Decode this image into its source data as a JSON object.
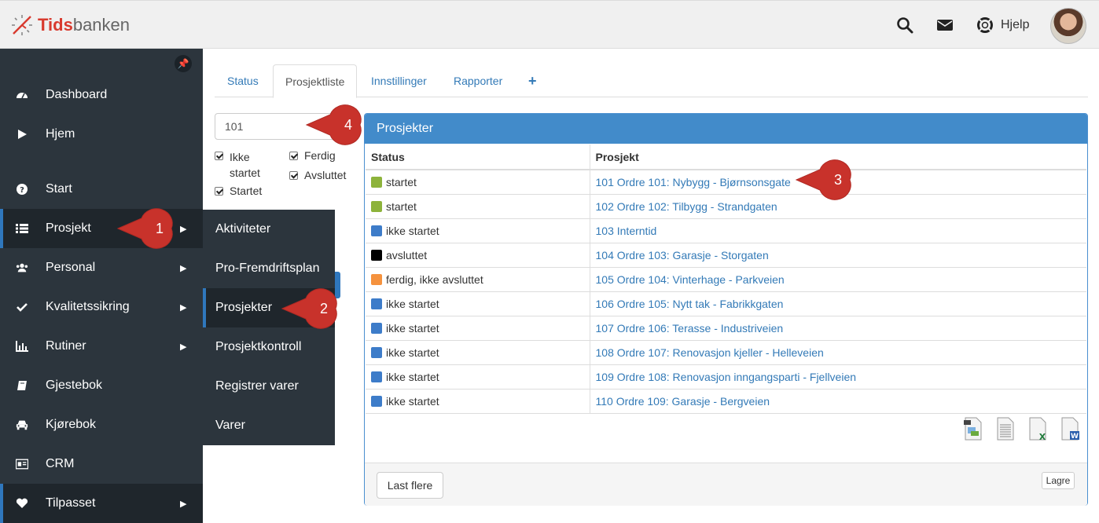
{
  "app": {
    "logo_bold": "Tids",
    "logo_rest": "banken",
    "brand_color": "#d83a2e"
  },
  "header": {
    "help_label": "Hjelp",
    "icons": [
      "search-icon",
      "envelope-icon",
      "lifebuoy-icon"
    ]
  },
  "sidebar": {
    "items": [
      {
        "label": "Dashboard",
        "icon": "dashboard-icon"
      },
      {
        "label": "Hjem",
        "icon": "play-icon"
      },
      {
        "label": "Start",
        "icon": "question-icon"
      },
      {
        "label": "Prosjekt",
        "icon": "list-icon",
        "active": true
      },
      {
        "label": "Personal",
        "icon": "users-icon"
      },
      {
        "label": "Kvalitetssikring",
        "icon": "check-icon"
      },
      {
        "label": "Rutiner",
        "icon": "bar-chart-icon"
      },
      {
        "label": "Gjestebok",
        "icon": "book-icon"
      },
      {
        "label": "Kjørebok",
        "icon": "car-icon"
      },
      {
        "label": "CRM",
        "icon": "id-card-icon"
      },
      {
        "label": "Tilpasset",
        "icon": "heart-icon"
      }
    ]
  },
  "submenu": {
    "items": [
      {
        "label": "Aktiviteter"
      },
      {
        "label": "Pro-Fremdriftsplan"
      },
      {
        "label": "Prosjekter",
        "active": true
      },
      {
        "label": "Prosjektkontroll"
      },
      {
        "label": "Registrer varer"
      },
      {
        "label": "Varer"
      }
    ]
  },
  "tabs": [
    {
      "label": "Status"
    },
    {
      "label": "Prosjektliste",
      "active": true
    },
    {
      "label": "Innstillinger"
    },
    {
      "label": "Rapporter"
    },
    {
      "label": "+"
    }
  ],
  "filter": {
    "search_value": "101",
    "checkboxes": [
      {
        "label": "Ikke startet",
        "checked": true
      },
      {
        "label": "Ferdig",
        "checked": true
      },
      {
        "label": "Startet",
        "checked": true
      },
      {
        "label": "Avsluttet",
        "checked": true
      }
    ]
  },
  "panel": {
    "title": "Prosjekter",
    "columns": [
      "Status",
      "Prosjekt"
    ],
    "rows": [
      {
        "status": "startet",
        "color": "#8db33b",
        "project": "101 Ordre 101: Nybygg - Bjørnsonsgate"
      },
      {
        "status": "startet",
        "color": "#8db33b",
        "project": "102 Ordre 102: Tilbygg - Strandgaten"
      },
      {
        "status": "ikke startet",
        "color": "#3d7cc9",
        "project": "103 Interntid"
      },
      {
        "status": "avsluttet",
        "color": "#000000",
        "project": "104 Ordre 103: Garasje - Storgaten"
      },
      {
        "status": "ferdig, ikke avsluttet",
        "color": "#f5923e",
        "project": "105 Ordre 104: Vinterhage - Parkveien"
      },
      {
        "status": "ikke startet",
        "color": "#3d7cc9",
        "project": "106 Ordre 105: Nytt tak - Fabrikkgaten"
      },
      {
        "status": "ikke startet",
        "color": "#3d7cc9",
        "project": "107 Ordre 106: Terasse - Industriveien"
      },
      {
        "status": "ikke startet",
        "color": "#3d7cc9",
        "project": "108 Ordre 107: Renovasjon kjeller - Helleveien"
      },
      {
        "status": "ikke startet",
        "color": "#3d7cc9",
        "project": "109 Ordre 108: Renovasjon inngangsparti - Fjellveien"
      },
      {
        "status": "ikke startet",
        "color": "#3d7cc9",
        "project": "110 Ordre 109: Garasje - Bergveien"
      }
    ],
    "export_icons": [
      "pdf-export-icon",
      "text-export-icon",
      "excel-export-icon",
      "word-export-icon"
    ],
    "load_more_label": "Last flere",
    "save_label": "Lagre"
  },
  "callouts": [
    "1",
    "2",
    "3",
    "4"
  ],
  "colors": {
    "sidebar_bg": "#2c353d",
    "accent": "#2f77bd",
    "panel_header": "#428bca",
    "callout": "#c8322b"
  }
}
